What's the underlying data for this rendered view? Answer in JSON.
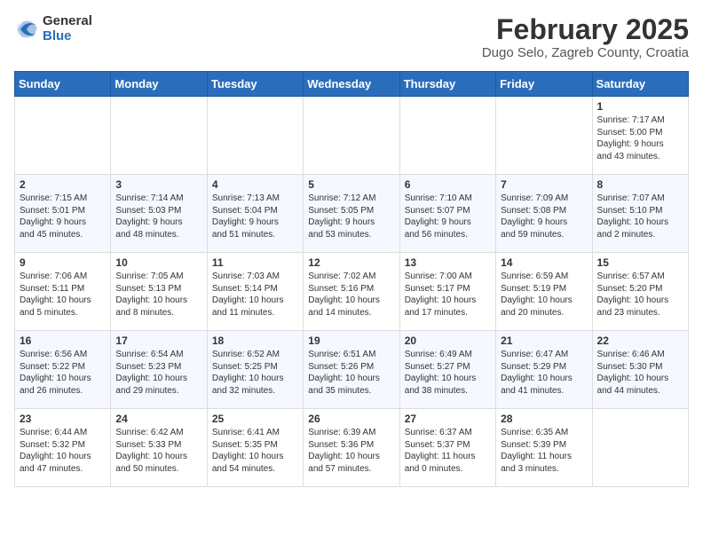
{
  "header": {
    "logo_general": "General",
    "logo_blue": "Blue",
    "month_year": "February 2025",
    "location": "Dugo Selo, Zagreb County, Croatia"
  },
  "weekdays": [
    "Sunday",
    "Monday",
    "Tuesday",
    "Wednesday",
    "Thursday",
    "Friday",
    "Saturday"
  ],
  "weeks": [
    [
      {
        "day": "",
        "info": ""
      },
      {
        "day": "",
        "info": ""
      },
      {
        "day": "",
        "info": ""
      },
      {
        "day": "",
        "info": ""
      },
      {
        "day": "",
        "info": ""
      },
      {
        "day": "",
        "info": ""
      },
      {
        "day": "1",
        "info": "Sunrise: 7:17 AM\nSunset: 5:00 PM\nDaylight: 9 hours\nand 43 minutes."
      }
    ],
    [
      {
        "day": "2",
        "info": "Sunrise: 7:15 AM\nSunset: 5:01 PM\nDaylight: 9 hours\nand 45 minutes."
      },
      {
        "day": "3",
        "info": "Sunrise: 7:14 AM\nSunset: 5:03 PM\nDaylight: 9 hours\nand 48 minutes."
      },
      {
        "day": "4",
        "info": "Sunrise: 7:13 AM\nSunset: 5:04 PM\nDaylight: 9 hours\nand 51 minutes."
      },
      {
        "day": "5",
        "info": "Sunrise: 7:12 AM\nSunset: 5:05 PM\nDaylight: 9 hours\nand 53 minutes."
      },
      {
        "day": "6",
        "info": "Sunrise: 7:10 AM\nSunset: 5:07 PM\nDaylight: 9 hours\nand 56 minutes."
      },
      {
        "day": "7",
        "info": "Sunrise: 7:09 AM\nSunset: 5:08 PM\nDaylight: 9 hours\nand 59 minutes."
      },
      {
        "day": "8",
        "info": "Sunrise: 7:07 AM\nSunset: 5:10 PM\nDaylight: 10 hours\nand 2 minutes."
      }
    ],
    [
      {
        "day": "9",
        "info": "Sunrise: 7:06 AM\nSunset: 5:11 PM\nDaylight: 10 hours\nand 5 minutes."
      },
      {
        "day": "10",
        "info": "Sunrise: 7:05 AM\nSunset: 5:13 PM\nDaylight: 10 hours\nand 8 minutes."
      },
      {
        "day": "11",
        "info": "Sunrise: 7:03 AM\nSunset: 5:14 PM\nDaylight: 10 hours\nand 11 minutes."
      },
      {
        "day": "12",
        "info": "Sunrise: 7:02 AM\nSunset: 5:16 PM\nDaylight: 10 hours\nand 14 minutes."
      },
      {
        "day": "13",
        "info": "Sunrise: 7:00 AM\nSunset: 5:17 PM\nDaylight: 10 hours\nand 17 minutes."
      },
      {
        "day": "14",
        "info": "Sunrise: 6:59 AM\nSunset: 5:19 PM\nDaylight: 10 hours\nand 20 minutes."
      },
      {
        "day": "15",
        "info": "Sunrise: 6:57 AM\nSunset: 5:20 PM\nDaylight: 10 hours\nand 23 minutes."
      }
    ],
    [
      {
        "day": "16",
        "info": "Sunrise: 6:56 AM\nSunset: 5:22 PM\nDaylight: 10 hours\nand 26 minutes."
      },
      {
        "day": "17",
        "info": "Sunrise: 6:54 AM\nSunset: 5:23 PM\nDaylight: 10 hours\nand 29 minutes."
      },
      {
        "day": "18",
        "info": "Sunrise: 6:52 AM\nSunset: 5:25 PM\nDaylight: 10 hours\nand 32 minutes."
      },
      {
        "day": "19",
        "info": "Sunrise: 6:51 AM\nSunset: 5:26 PM\nDaylight: 10 hours\nand 35 minutes."
      },
      {
        "day": "20",
        "info": "Sunrise: 6:49 AM\nSunset: 5:27 PM\nDaylight: 10 hours\nand 38 minutes."
      },
      {
        "day": "21",
        "info": "Sunrise: 6:47 AM\nSunset: 5:29 PM\nDaylight: 10 hours\nand 41 minutes."
      },
      {
        "day": "22",
        "info": "Sunrise: 6:46 AM\nSunset: 5:30 PM\nDaylight: 10 hours\nand 44 minutes."
      }
    ],
    [
      {
        "day": "23",
        "info": "Sunrise: 6:44 AM\nSunset: 5:32 PM\nDaylight: 10 hours\nand 47 minutes."
      },
      {
        "day": "24",
        "info": "Sunrise: 6:42 AM\nSunset: 5:33 PM\nDaylight: 10 hours\nand 50 minutes."
      },
      {
        "day": "25",
        "info": "Sunrise: 6:41 AM\nSunset: 5:35 PM\nDaylight: 10 hours\nand 54 minutes."
      },
      {
        "day": "26",
        "info": "Sunrise: 6:39 AM\nSunset: 5:36 PM\nDaylight: 10 hours\nand 57 minutes."
      },
      {
        "day": "27",
        "info": "Sunrise: 6:37 AM\nSunset: 5:37 PM\nDaylight: 11 hours\nand 0 minutes."
      },
      {
        "day": "28",
        "info": "Sunrise: 6:35 AM\nSunset: 5:39 PM\nDaylight: 11 hours\nand 3 minutes."
      },
      {
        "day": "",
        "info": ""
      }
    ]
  ]
}
